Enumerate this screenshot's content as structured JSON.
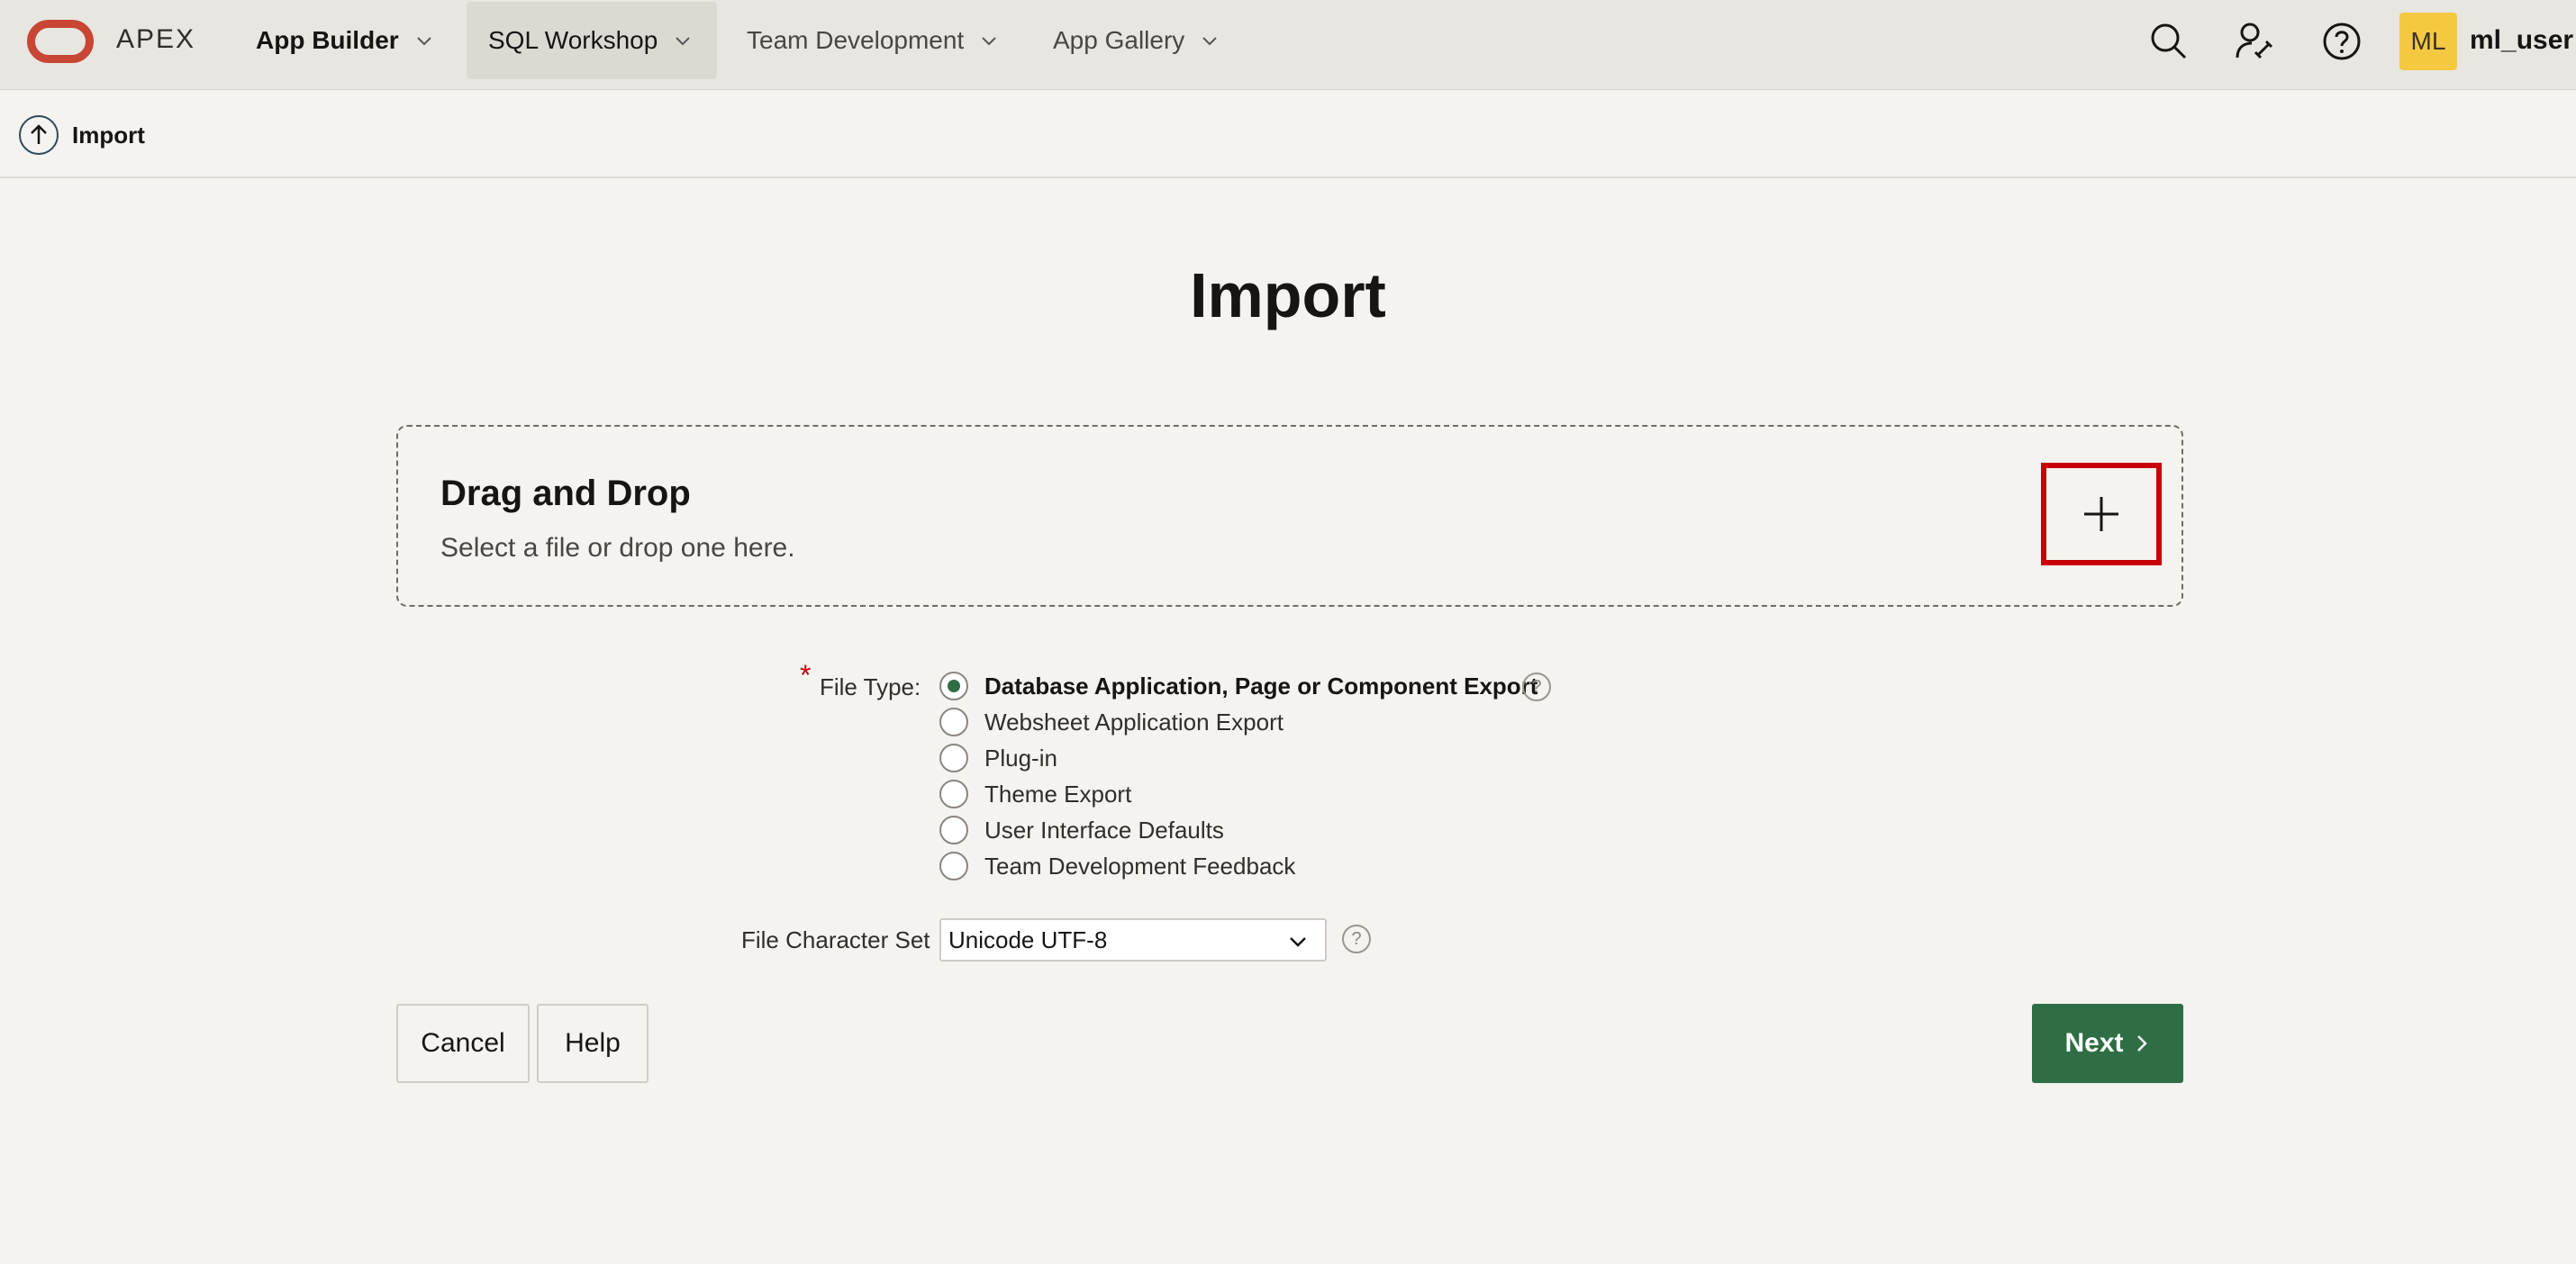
{
  "brand": "APEX",
  "nav": {
    "items": [
      {
        "label": "App Builder"
      },
      {
        "label": "SQL Workshop"
      },
      {
        "label": "Team Development"
      },
      {
        "label": "App Gallery"
      }
    ]
  },
  "user": {
    "initials": "ML",
    "name": "ml_user"
  },
  "breadcrumb": {
    "label": "Import"
  },
  "page": {
    "title": "Import"
  },
  "dropzone": {
    "title": "Drag and Drop",
    "subtitle": "Select a file or drop one here."
  },
  "form": {
    "file_type_label": "File Type:",
    "required_mark": "*",
    "file_type_options": [
      {
        "label": "Database Application, Page or Component Export",
        "checked": true
      },
      {
        "label": "Websheet Application Export",
        "checked": false
      },
      {
        "label": "Plug-in",
        "checked": false
      },
      {
        "label": "Theme Export",
        "checked": false
      },
      {
        "label": "User Interface Defaults",
        "checked": false
      },
      {
        "label": "Team Development Feedback",
        "checked": false
      }
    ],
    "charset_label": "File Character Set",
    "charset_value": "Unicode UTF-8",
    "help_glyph": "?"
  },
  "buttons": {
    "cancel": "Cancel",
    "help": "Help",
    "next": "Next"
  },
  "colors": {
    "accent": "#2f6e44",
    "highlight_box": "#c8000a",
    "brand": "#c74634"
  }
}
